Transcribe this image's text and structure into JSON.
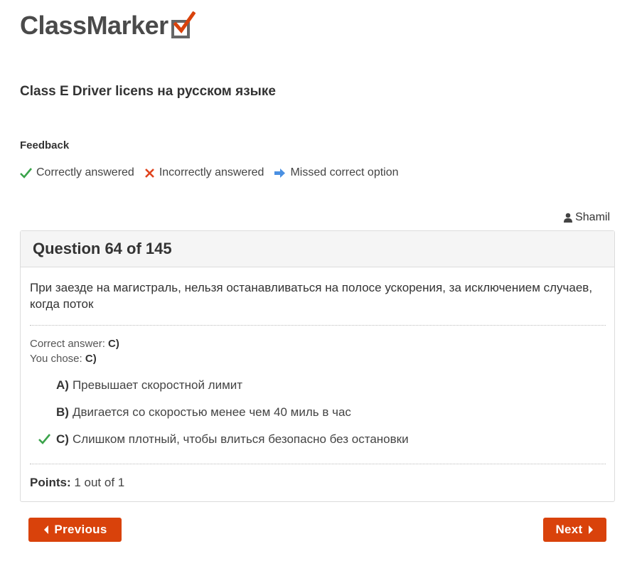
{
  "logo": {
    "text": "ClassMarker"
  },
  "test": {
    "title": "Class E Driver licens на русском языке"
  },
  "feedback": {
    "heading": "Feedback",
    "legend": {
      "correct": "Correctly answered",
      "incorrect": "Incorrectly answered",
      "missed": "Missed correct option"
    }
  },
  "user": {
    "name": "Shamil"
  },
  "question": {
    "heading": "Question 64 of 145",
    "text": "При заезде на магистраль, нельзя останавливаться на полосе ускорения, за исключением случаев, когда поток",
    "correct_label": "Correct answer:",
    "correct_value": "C)",
    "chose_label": "You chose:",
    "chose_value": "C)",
    "options": [
      {
        "letter": "A)",
        "text": "Превышает скоростной лимит"
      },
      {
        "letter": "B)",
        "text": "Двигается со скоростью менее чем 40 миль в час"
      },
      {
        "letter": "C)",
        "text": "Слишком плотный, чтобы влиться безопасно без остановки"
      }
    ],
    "points_label": "Points:",
    "points_value": "1 out of 1"
  },
  "nav": {
    "previous": "Previous",
    "next": "Next"
  },
  "colors": {
    "accent": "#d9420b",
    "correct": "#3aa34a",
    "incorrect": "#e0421c",
    "missed": "#4a90e2"
  },
  "icons": {
    "correct": "check-icon",
    "incorrect": "cross-icon",
    "missed": "arrow-right-icon",
    "user": "user-icon",
    "prev": "caret-left-icon",
    "next": "caret-right-icon"
  }
}
